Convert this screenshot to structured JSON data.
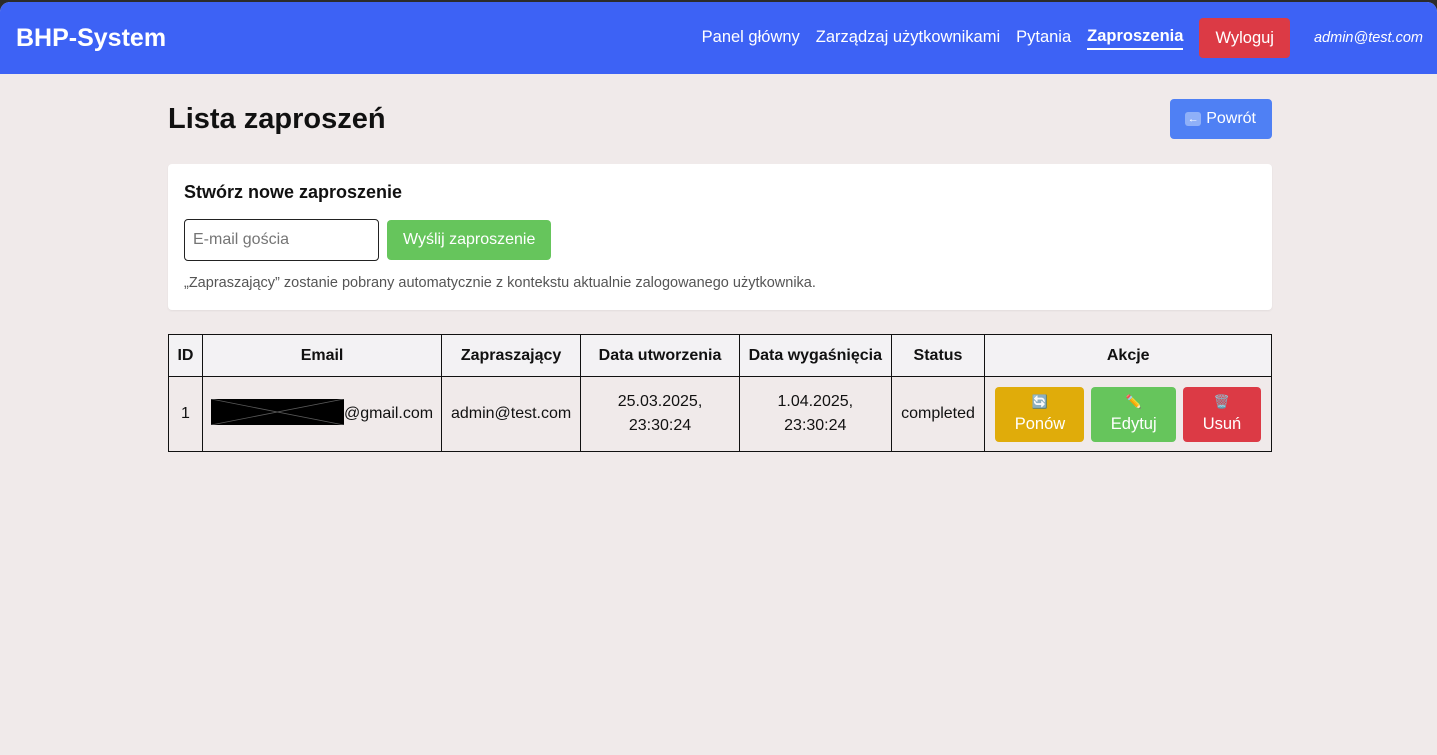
{
  "navbar": {
    "brand": "BHP-System",
    "links": [
      "Panel główny",
      "Zarządzaj użytkownikami",
      "Pytania",
      "Zaproszenia"
    ],
    "active_link": "Zaproszenia",
    "logout_label": "Wyloguj",
    "user_email": "admin@test.com",
    "colors": {
      "background": "#3d62f5",
      "logout": "#dc3a45"
    }
  },
  "page": {
    "title": "Lista zaproszeń",
    "back_button": {
      "label": "Powrót",
      "icon": "left-arrow-icon"
    }
  },
  "create_card": {
    "title": "Stwórz nowe zaproszenie",
    "email_input": {
      "placeholder": "E-mail gościa",
      "value": ""
    },
    "submit_label": "Wyślij zaproszenie",
    "helper_text": "„Zapraszający” zostanie pobrany automatycznie z kontekstu aktualnie zalogowanego użytkownika."
  },
  "table": {
    "headers": [
      "ID",
      "Email",
      "Zapraszający",
      "Data utworzenia",
      "Data wygaśnięcia",
      "Status",
      "Akcje"
    ],
    "rows": [
      {
        "id": "1",
        "email_suffix": "@gmail.com",
        "inviter": "admin@test.com",
        "created_date": "25.03.2025,",
        "created_time": "23:30:24",
        "expires_date": "1.04.2025,",
        "expires_time": "23:30:24",
        "status": "completed",
        "actions": [
          {
            "label": "Ponów",
            "icon": "refresh-icon",
            "color": "#e0ac0a"
          },
          {
            "label": "Edytuj",
            "icon": "pencil-icon",
            "color": "#66c55c"
          },
          {
            "label": "Usuń",
            "icon": "trash-icon",
            "color": "#dc3a45"
          }
        ]
      }
    ]
  }
}
